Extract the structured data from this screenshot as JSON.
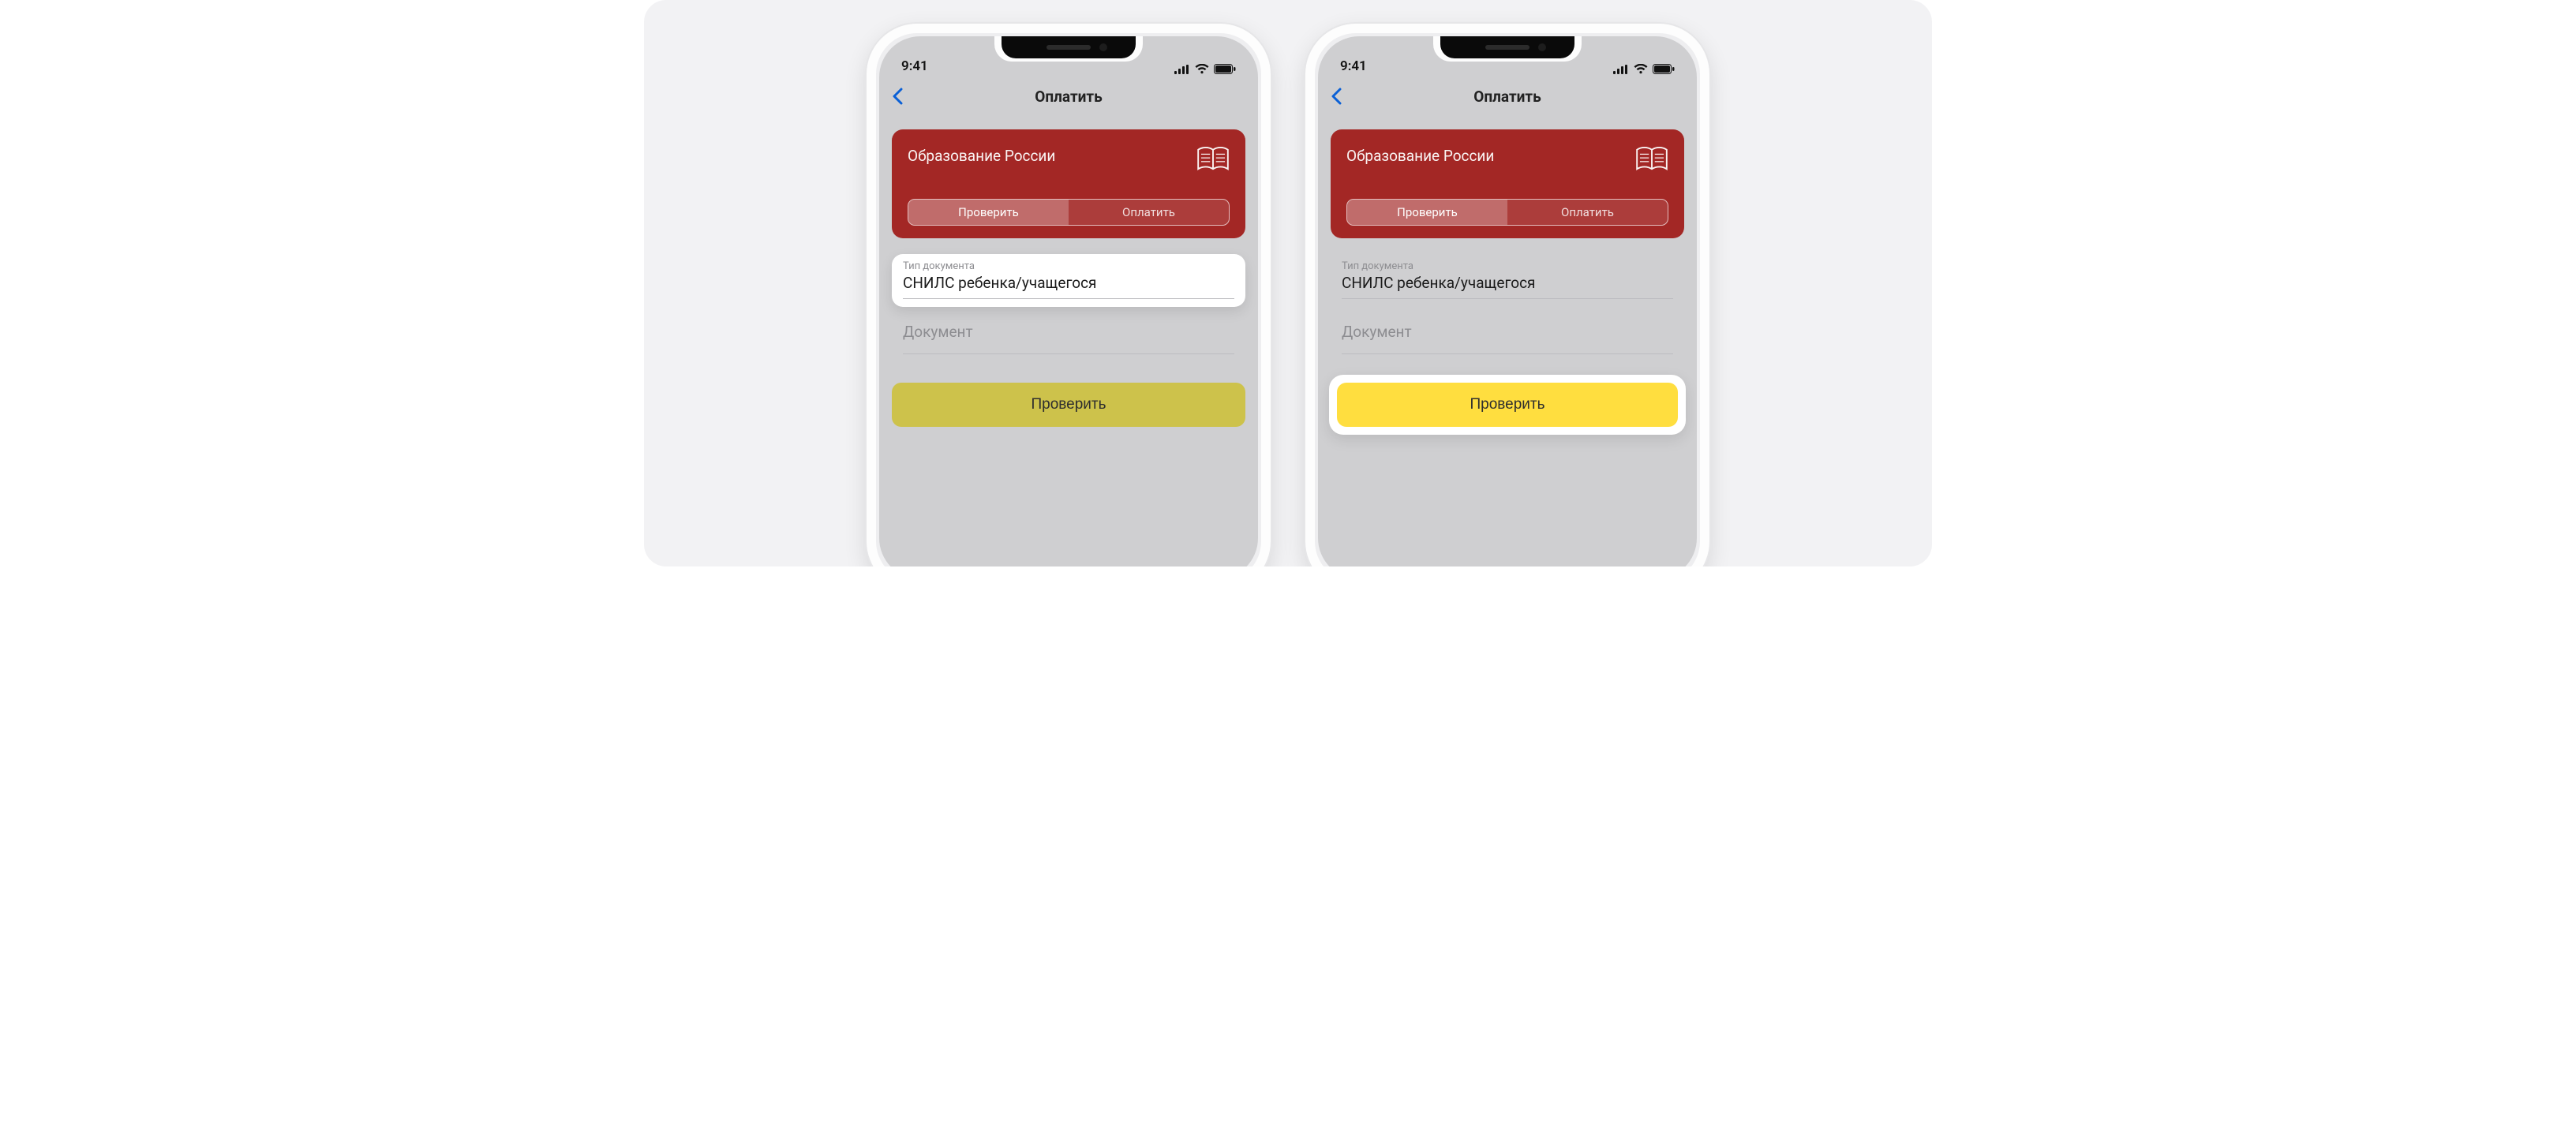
{
  "status": {
    "time": "9:41"
  },
  "nav": {
    "title": "Оплатить"
  },
  "card": {
    "title": "Образование России",
    "segments": {
      "check": "Проверить",
      "pay": "Оплатить"
    }
  },
  "docType": {
    "label": "Тип документа",
    "value": "СНИЛС ребенка/учащегося"
  },
  "docInput": {
    "placeholder": "Документ"
  },
  "primary": {
    "label": "Проверить"
  }
}
